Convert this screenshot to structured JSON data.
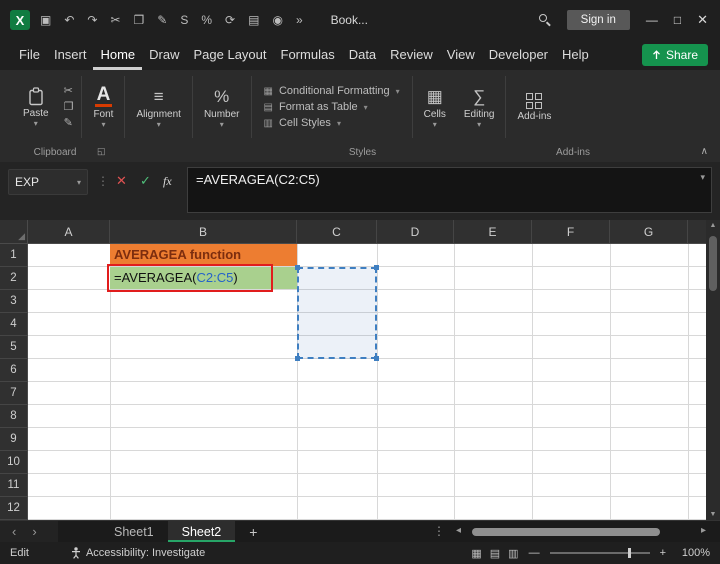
{
  "window": {
    "document_name": "Book...",
    "signin_label": "Sign in"
  },
  "icons": {
    "excel_logo": "X",
    "save": "▣",
    "undo": "↶",
    "redo": "↷",
    "cut": "✂",
    "copy": "❐",
    "format_painter": "✎",
    "bold_s": "S",
    "percent": "%",
    "refresh": "⟳",
    "document": "▤",
    "camera": "◉",
    "more": "»",
    "dropdown": "▾",
    "close_formula": "✕",
    "check": "✓",
    "dots_v": "⋮",
    "align": "≡",
    "cells": "▦",
    "editing": "∑",
    "cf": "▦",
    "fat": "▤",
    "cs": "▥",
    "launcher": "◱",
    "collapse": "∧",
    "scroll_up": "▲",
    "scroll_down": "▼",
    "scroll_left": "◂",
    "scroll_right": "▸",
    "tab_prev": "‹",
    "tab_next": "›",
    "select_all": "◢",
    "view_normal": "▦",
    "view_layout": "▤",
    "view_break": "▥",
    "zoom_out": "—",
    "zoom_in": "+",
    "minimize": "—",
    "maximize": "□",
    "close": "✕"
  },
  "menubar": {
    "items": [
      "File",
      "Insert",
      "Home",
      "Draw",
      "Page Layout",
      "Formulas",
      "Data",
      "Review",
      "View",
      "Developer",
      "Help"
    ],
    "active": "Home",
    "share_label": "Share"
  },
  "ribbon": {
    "paste_label": "Paste",
    "font_label": "Font",
    "alignment_label": "Alignment",
    "number_label": "Number",
    "styles_items": [
      "Conditional Formatting",
      "Format as Table",
      "Cell Styles"
    ],
    "cells_label": "Cells",
    "editing_label": "Editing",
    "addins_label": "Add-ins",
    "group_labels": {
      "clipboard": "Clipboard",
      "styles": "Styles",
      "addins": "Add-ins"
    }
  },
  "formula_bar": {
    "name_box": "EXP",
    "formula": "=AVERAGEA(C2:C5)",
    "fx": "fx"
  },
  "grid": {
    "columns": [
      "A",
      "B",
      "C",
      "D",
      "E",
      "F",
      "G"
    ],
    "rows": [
      "1",
      "2",
      "3",
      "4",
      "5",
      "6",
      "7",
      "8",
      "9",
      "10",
      "11",
      "12"
    ],
    "cells": {
      "B1": {
        "text": "AVERAGEA function",
        "bg": "#ED7D31",
        "text_color": "#7C2D0E"
      },
      "B2": {
        "prefix": "=AVERAGEA(",
        "ref": "C2:C5",
        "suffix": ")",
        "bg": "#A9D08E",
        "ref_color": "#2563C9"
      }
    },
    "selection_range": "C2:C5"
  },
  "sheet_tabs": {
    "tabs": [
      "Sheet1",
      "Sheet2"
    ],
    "active": "Sheet2",
    "add_label": "+"
  },
  "status_bar": {
    "mode": "Edit",
    "accessibility": "Accessibility: Investigate",
    "zoom": "100%"
  },
  "colors": {
    "accent_green": "#15934E",
    "selection_blue": "#3F7FC1",
    "annotation_red": "#E11D1D",
    "cell_orange": "#ED7D31",
    "cell_green": "#A9D08E"
  }
}
